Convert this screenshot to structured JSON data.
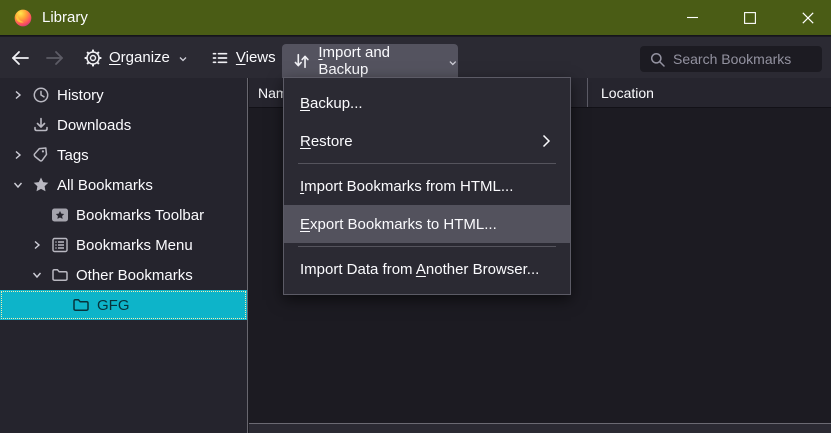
{
  "window": {
    "title": "Library",
    "controls": {
      "minimize": "minimize",
      "maximize": "maximize",
      "close": "close"
    }
  },
  "toolbar": {
    "organize": {
      "pre": "",
      "key": "O",
      "post": "rganize"
    },
    "views": {
      "pre": "",
      "key": "V",
      "post": "iews"
    },
    "import_backup": {
      "pre": "",
      "key": "I",
      "post": "mport and Backup"
    },
    "search_placeholder": "Search Bookmarks"
  },
  "columns": {
    "name": "Name",
    "location": "Location"
  },
  "sidebar": {
    "items": [
      {
        "label": "History"
      },
      {
        "label": "Downloads"
      },
      {
        "label": "Tags"
      },
      {
        "label": "All Bookmarks"
      },
      {
        "label": "Bookmarks Toolbar"
      },
      {
        "label": "Bookmarks Menu"
      },
      {
        "label": "Other Bookmarks"
      },
      {
        "label": "GFG"
      }
    ]
  },
  "menu": {
    "items": [
      {
        "pre": "",
        "key": "B",
        "post": "ackup..."
      },
      {
        "pre": "",
        "key": "R",
        "post": "estore"
      },
      {
        "pre": "",
        "key": "I",
        "post": "mport Bookmarks from HTML..."
      },
      {
        "pre": "",
        "key": "E",
        "post": "xport Bookmarks to HTML..."
      },
      {
        "pre": "Import Data from ",
        "key": "A",
        "post": "nother Browser..."
      }
    ]
  },
  "colors": {
    "titlebar_green": "#4a5c15",
    "selection_cyan": "#0db4c9",
    "toolbar_bg": "#2b2a33",
    "panel_bg": "#1c1b22",
    "menu_highlight": "#53525d"
  }
}
